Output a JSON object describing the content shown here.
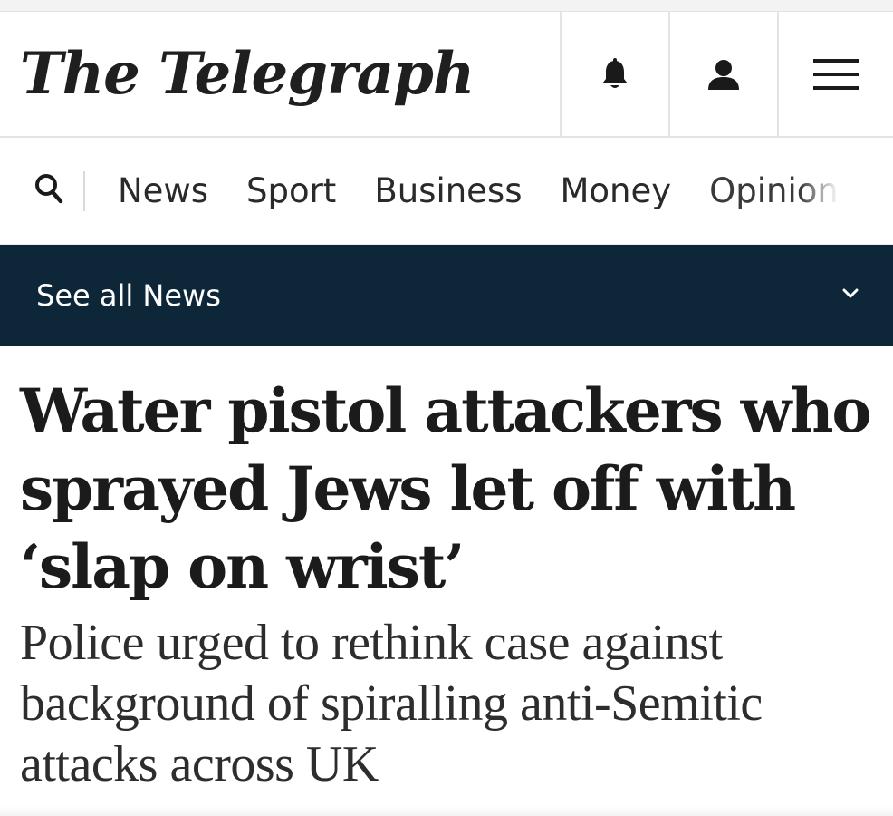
{
  "brand": {
    "logo_text": "The Telegraph"
  },
  "header": {
    "icons": [
      "bell-icon",
      "user-icon",
      "menu-icon"
    ]
  },
  "nav": {
    "search_icon": "search-icon",
    "items": [
      "News",
      "Sport",
      "Business",
      "Money",
      "Opinion"
    ]
  },
  "subnav": {
    "label": "See all News",
    "icon": "chevron-down-icon"
  },
  "article": {
    "headline": "Water pistol attackers who sprayed Jews let off with ‘slap on wrist’",
    "standfirst": "Police urged to rethink case against background of spiralling anti-Semitic attacks across UK"
  },
  "colors": {
    "subnav_bg": "#0d2739",
    "text": "#1b1b1b"
  }
}
